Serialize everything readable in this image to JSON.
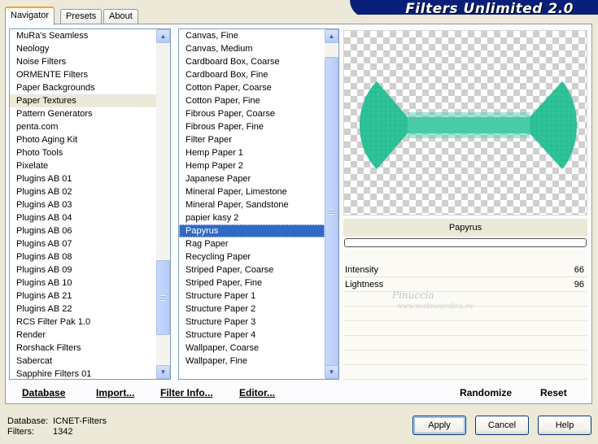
{
  "tabs": [
    {
      "label": "Navigator",
      "active": true
    },
    {
      "label": "Presets",
      "active": false
    },
    {
      "label": "About",
      "active": false
    }
  ],
  "title": "Filters Unlimited 2.0",
  "categories": {
    "items": [
      "MuRa's Seamless",
      "Neology",
      "Noise Filters",
      "ORMENTE Filters",
      "Paper Backgrounds",
      "Paper Textures",
      "Pattern Generators",
      "penta.com",
      "Photo Aging Kit",
      "Photo Tools",
      "Pixelate",
      "Plugins AB 01",
      "Plugins AB 02",
      "Plugins AB 03",
      "Plugins AB 04",
      "Plugins AB 06",
      "Plugins AB 07",
      "Plugins AB 08",
      "Plugins AB 09",
      "Plugins AB 10",
      "Plugins AB 21",
      "Plugins AB 22",
      "RCS Filter Pak 1.0",
      "Render",
      "Rorshack Filters",
      "Sabercat",
      "Sapphire Filters 01"
    ],
    "selected": "Paper Textures"
  },
  "filters": {
    "items": [
      "Canvas, Fine",
      "Canvas, Medium",
      "Cardboard Box, Coarse",
      "Cardboard Box, Fine",
      "Cotton Paper, Coarse",
      "Cotton Paper, Fine",
      "Fibrous Paper, Coarse",
      "Fibrous Paper, Fine",
      "Filter Paper",
      "Hemp Paper 1",
      "Hemp Paper 2",
      "Japanese Paper",
      "Mineral Paper, Limestone",
      "Mineral Paper, Sandstone",
      "papier kasy 2",
      "Papyrus",
      "Rag Paper",
      "Recycling Paper",
      "Striped Paper, Coarse",
      "Striped Paper, Fine",
      "Structure Paper 1",
      "Structure Paper 2",
      "Structure Paper 3",
      "Structure Paper 4",
      "Wallpaper, Coarse",
      "Wallpaper, Fine"
    ],
    "selected": "Papyrus"
  },
  "preview": {
    "filter_name": "Papyrus",
    "progress": 0,
    "shape_color": "#2ec49a"
  },
  "params": [
    {
      "name": "Intensity",
      "value": "66"
    },
    {
      "name": "Lightness",
      "value": "96"
    }
  ],
  "watermark": {
    "line1": "Pinuccia",
    "line2": "www.mudrasgrafica.eu"
  },
  "actions": {
    "database": "Database",
    "import": "Import...",
    "filter_info": "Filter Info...",
    "editor": "Editor...",
    "randomize": "Randomize",
    "reset": "Reset"
  },
  "footer": {
    "database_label": "Database:",
    "database_value": "ICNET-Filters",
    "filters_label": "Filters:",
    "filters_value": "1342"
  },
  "buttons": {
    "apply": "Apply",
    "cancel": "Cancel",
    "help": "Help"
  },
  "colors": {
    "selection": "#316ac5",
    "title_bar": "#0a1f7a",
    "window_bg": "#ece9d8"
  }
}
